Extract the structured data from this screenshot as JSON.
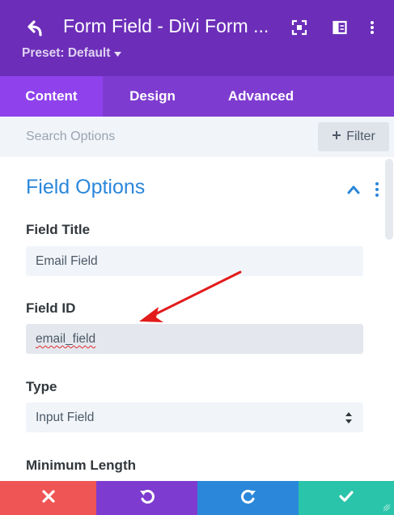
{
  "header": {
    "title": "Form Field - Divi Form ...",
    "preset_label": "Preset: Default",
    "icons": [
      "back-arrow-icon",
      "fullscreen-icon",
      "split-view-icon",
      "more-vert-icon"
    ],
    "bg_color": "#6c2eb9"
  },
  "tabs": [
    {
      "label": "Content",
      "active": true
    },
    {
      "label": "Design",
      "active": false
    },
    {
      "label": "Advanced",
      "active": false
    }
  ],
  "search": {
    "placeholder": "Search Options",
    "filter_label": "Filter"
  },
  "section": {
    "title": "Field Options",
    "expanded": true
  },
  "fields": {
    "field_title": {
      "label": "Field Title",
      "value": "Email Field"
    },
    "field_id": {
      "label": "Field ID",
      "value": "email_field"
    },
    "type": {
      "label": "Type",
      "value": "Input Field",
      "options": [
        "Input Field"
      ]
    },
    "min_length": {
      "label": "Minimum Length"
    }
  },
  "footer": {
    "icons": [
      "close-icon",
      "undo-icon",
      "redo-icon",
      "check-icon"
    ],
    "colors": {
      "discard": "#ef5555",
      "undo": "#7e3bd0",
      "redo": "#2b87da",
      "save": "#29c4a9"
    }
  },
  "colors": {
    "accent_blue": "#2b87da",
    "tab_active": "#8f42ec",
    "annotation_arrow": "#e21b1b"
  }
}
